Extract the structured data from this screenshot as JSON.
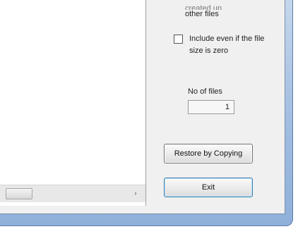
{
  "right_panel": {
    "other_files_cut": "created up",
    "other_files_label": "other files",
    "include_zero_size_label": "Include even if the file size is zero",
    "include_zero_size_checked": false,
    "no_of_files_label": "No of files",
    "no_of_files_value": "1",
    "restore_button_label": "Restore by Copying",
    "exit_button_label": "Exit"
  },
  "left_panel": {
    "scroll_right_arrow": "›"
  }
}
